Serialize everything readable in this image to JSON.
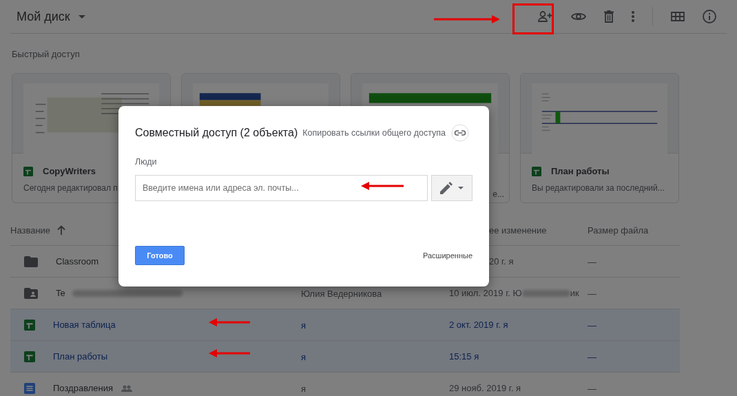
{
  "drive": {
    "title": "Мой диск"
  },
  "quick_access": {
    "title": "Быстрый доступ",
    "cards": [
      {
        "kind": "sheet",
        "name": "CopyWriters",
        "subtitle": "Сегодня редактировал п"
      },
      {
        "kind": "banner"
      },
      {
        "kind": "bar-sheet",
        "subtitle": "е...",
        "partly_hidden": true
      },
      {
        "kind": "sheet",
        "name": "План работы",
        "subtitle": "Вы редактировали за последний..."
      }
    ]
  },
  "table": {
    "columns": [
      {
        "label": "Название",
        "sorted": true
      },
      {
        "label": "ее изменение",
        "partly_hidden": true
      },
      {
        "label": "Размер файла"
      }
    ],
    "rows": [
      {
        "kind": "folder",
        "name": "Classroom",
        "modified": "20 г. я",
        "modified_partly_hidden": true,
        "size": "—",
        "selected": false
      },
      {
        "kind": "shared-folder",
        "name": "Te",
        "name_blurred": true,
        "owner": "Юлия Ведерникова",
        "modified": "10 июл. 2019 г. Ю",
        "modified_blurred": true,
        "modified_tail": "ик",
        "size": "—",
        "selected": false
      },
      {
        "kind": "sheet",
        "name": "Новая таблица",
        "owner": "я",
        "modified": "2 окт. 2019 г. я",
        "size": "—",
        "selected": true
      },
      {
        "kind": "sheet",
        "name": "План работы",
        "owner": "я",
        "modified": "15:15 я",
        "size": "—",
        "selected": true
      },
      {
        "kind": "doc",
        "name": "Поздравления",
        "shared": true,
        "owner": "я",
        "modified": "29 нояб. 2019 г. я",
        "size": "—",
        "selected": false
      }
    ]
  },
  "share_dialog": {
    "title": "Совместный доступ (2 объекта)",
    "copy_link": "Копировать ссылки общего доступа",
    "people_label": "Люди",
    "people_input": {
      "placeholder": "Введите имена или адреса эл. почты..."
    },
    "done_button": "Готово",
    "advanced_link": "Расширенные"
  }
}
